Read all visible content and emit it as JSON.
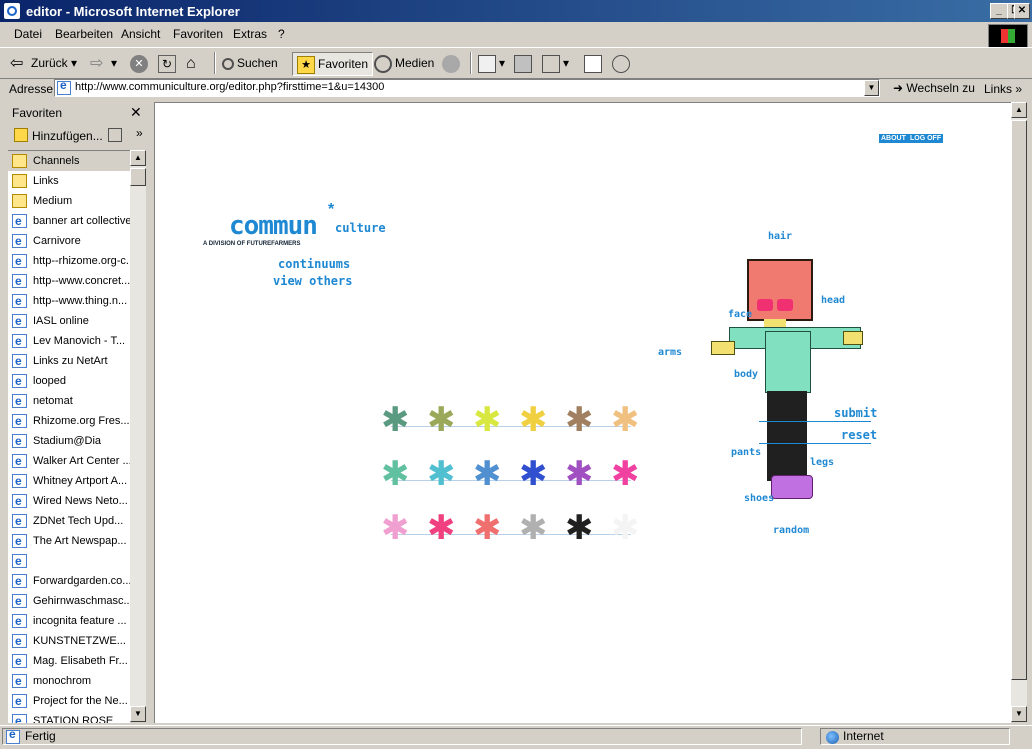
{
  "window": {
    "title": "editor - Microsoft Internet Explorer"
  },
  "menu": [
    "Datei",
    "Bearbeiten",
    "Ansicht",
    "Favoriten",
    "Extras",
    "?"
  ],
  "toolbar": {
    "back": "Zurück",
    "search": "Suchen",
    "favorites": "Favoriten",
    "media": "Medien"
  },
  "address": {
    "label": "Adresse",
    "url": "http://www.communiculture.org/editor.php?firsttime=1&u=14300",
    "go": "Wechseln zu",
    "links": "Links"
  },
  "favorites_pane": {
    "title": "Favoriten",
    "add": "Hinzufügen...",
    "items": [
      {
        "label": "Channels",
        "type": "folder"
      },
      {
        "label": "Links",
        "type": "folder"
      },
      {
        "label": "Medium",
        "type": "folder"
      },
      {
        "label": "banner art collective",
        "type": "link"
      },
      {
        "label": "Carnivore",
        "type": "link"
      },
      {
        "label": "http--rhizome.org-c...",
        "type": "link"
      },
      {
        "label": "http--www.concret...",
        "type": "link"
      },
      {
        "label": "http--www.thing.n...",
        "type": "link"
      },
      {
        "label": "IASL online",
        "type": "link"
      },
      {
        "label": "Lev Manovich - T...",
        "type": "link"
      },
      {
        "label": "Links zu NetArt",
        "type": "link"
      },
      {
        "label": "looped",
        "type": "link"
      },
      {
        "label": "netomat",
        "type": "link"
      },
      {
        "label": "Rhizome.org Fres...",
        "type": "link"
      },
      {
        "label": "Stadium@Dia",
        "type": "link"
      },
      {
        "label": "Walker Art Center ...",
        "type": "link"
      },
      {
        "label": "Whitney Artport A...",
        "type": "link"
      },
      {
        "label": "Wired News Neto...",
        "type": "link"
      },
      {
        "label": "ZDNet Tech Upd...",
        "type": "link"
      },
      {
        "label": "The Art Newspap...",
        "type": "link"
      },
      {
        "label": "",
        "type": "link"
      },
      {
        "label": "Forwardgarden.co...",
        "type": "link"
      },
      {
        "label": "Gehirnwaschmasc...",
        "type": "link"
      },
      {
        "label": "incognita feature ...",
        "type": "link"
      },
      {
        "label": "KUNSTNETZWE...",
        "type": "link"
      },
      {
        "label": "Mag. Elisabeth Fr...",
        "type": "link"
      },
      {
        "label": "monochrom",
        "type": "link"
      },
      {
        "label": "Project for the Ne...",
        "type": "link"
      },
      {
        "label": "STATION ROSE",
        "type": "link"
      }
    ]
  },
  "site": {
    "about": "ABOUT",
    "logoff": "LOG OFF",
    "logo": "commun",
    "logo_suffix": "culture",
    "logo_star": "*",
    "tagline": "A DIVISION OF FUTUREFARMERS",
    "nav": [
      "continuums",
      "view others"
    ],
    "part_labels": [
      "hair",
      "head",
      "face",
      "arms",
      "body",
      "pants",
      "legs",
      "shoes",
      "random"
    ],
    "actions": {
      "submit": "submit",
      "reset": "reset"
    },
    "palette_colors": [
      [
        "#5a9a80",
        "#9aa85a",
        "#d8e840",
        "#f0d040",
        "#a08060",
        "#f0c080"
      ],
      [
        "#60c0a0",
        "#50c0d0",
        "#5090d0",
        "#3050d0",
        "#a050c0",
        "#f040a0"
      ],
      [
        "#f0a0d0",
        "#f04080",
        "#f07070",
        "#b0b0b0",
        "#202020",
        "#f4f4f4"
      ]
    ]
  },
  "status": {
    "left": "Fertig",
    "zone": "Internet"
  }
}
